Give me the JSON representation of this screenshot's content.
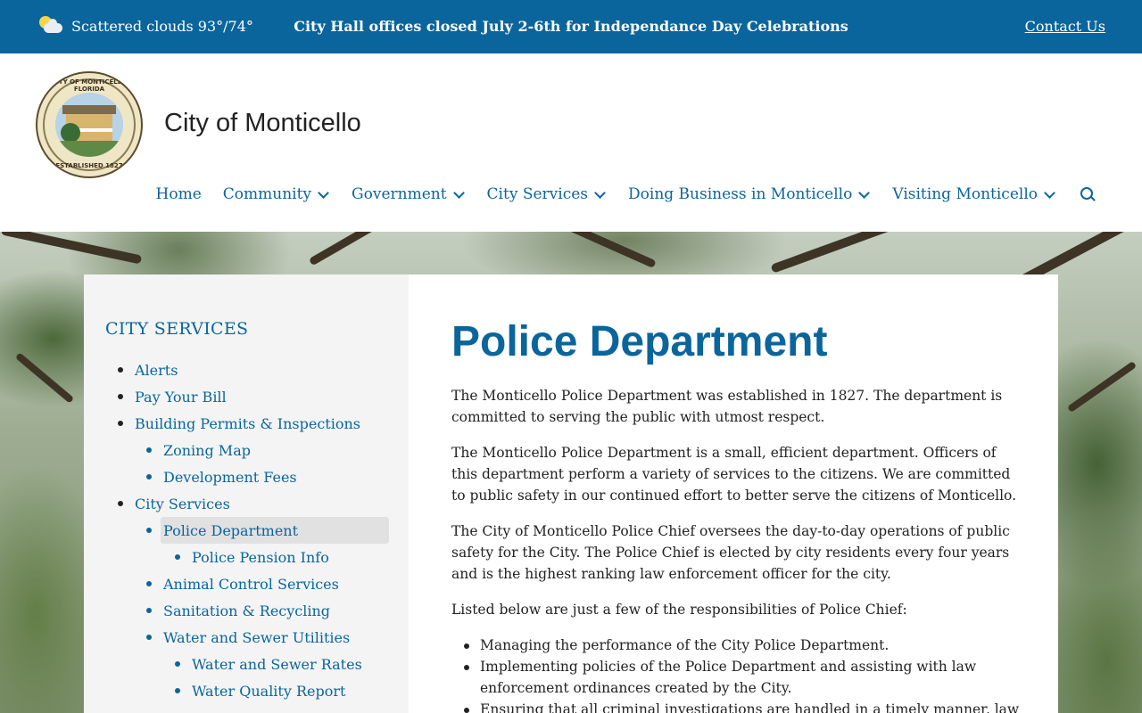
{
  "topbar": {
    "weather": "Scattered clouds 93°/74°",
    "alert": "City Hall offices closed July 2-6th for Independance Day Celebrations",
    "contact": "Contact Us"
  },
  "header": {
    "site_title": "City of Monticello",
    "seal_top_text": "CITY OF MONTICELLO FLORIDA",
    "seal_bottom_text": "ESTABLISHED 1827"
  },
  "nav": {
    "items": [
      "Home",
      "Community",
      "Government",
      "City Services",
      "Doing Business in Monticello",
      "Visiting Monticello"
    ]
  },
  "sidebar": {
    "title": "CITY SERVICES",
    "items": [
      {
        "label": "Alerts",
        "level": 1
      },
      {
        "label": "Pay Your Bill",
        "level": 1
      },
      {
        "label": "Building Permits & Inspections",
        "level": 1
      },
      {
        "label": "Zoning Map",
        "level": 2
      },
      {
        "label": "Development Fees",
        "level": 2
      },
      {
        "label": "City Services",
        "level": 1
      },
      {
        "label": "Police Department",
        "level": 2,
        "active": true
      },
      {
        "label": "Police Pension Info",
        "level": 3
      },
      {
        "label": "Animal Control Services",
        "level": 2
      },
      {
        "label": "Sanitation & Recycling",
        "level": 2
      },
      {
        "label": "Water and Sewer Utilities",
        "level": 2
      },
      {
        "label": "Water and Sewer Rates",
        "level": 3
      },
      {
        "label": "Water Quality Report",
        "level": 3
      }
    ]
  },
  "main": {
    "title": "Police Department",
    "paragraphs": [
      "The Monticello Police Department was established in 1827.  The department is committed to serving the public with utmost respect.",
      "The Monticello Police Department is a small, efficient department.  Officers of this department perform a variety of services to the citizens.  We are committed to public safety in our continued effort to better serve the citizens of Monticello.",
      "The City of Monticello Police Chief oversees the day-to-day operations of public safety for the City.  The Police Chief is elected by city residents every four years and is the highest ranking law enforcement officer for the city.",
      "Listed below are just a few of the responsibilities of Police Chief:"
    ],
    "bullets": [
      "Managing the performance of the City Police Department.",
      "Implementing policies of the Police Department and assisting with law enforcement ordinances created by the City.",
      "Ensuring that all criminal investigations are handled in a timely manner, law"
    ]
  }
}
